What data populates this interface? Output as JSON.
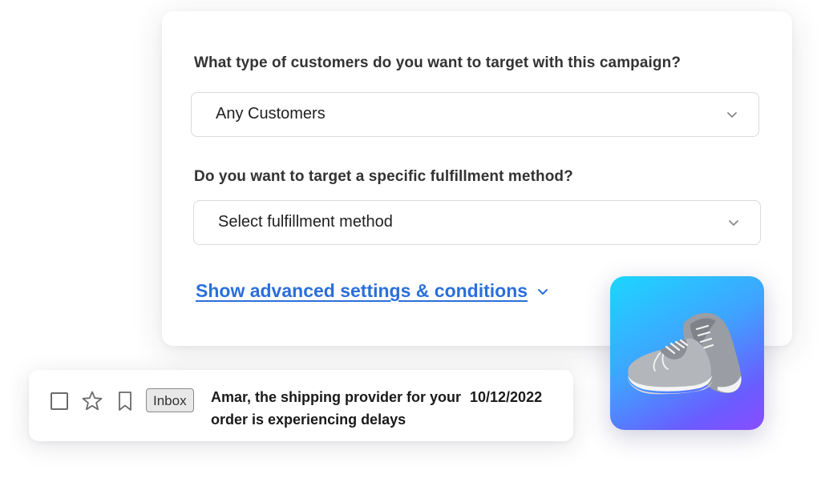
{
  "form": {
    "question_customers": "What type of customers do you want to target with this campaign?",
    "customers_select": {
      "value": "Any Customers"
    },
    "question_fulfillment": "Do you want to target a specific fulfillment method?",
    "fulfillment_select": {
      "value": "Select fulfillment method"
    },
    "advanced_link": "Show advanced settings & conditions"
  },
  "email": {
    "badge": "Inbox",
    "subject": "Amar, the shipping provider for your order is experiencing delays",
    "date": "10/12/2022"
  },
  "icons": {
    "select_chevron": "chevron-down-icon",
    "advanced_chevron": "chevron-down-icon",
    "checkbox": "checkbox-icon",
    "star": "star-icon",
    "bookmark": "bookmark-icon",
    "product": "sneakers-image"
  },
  "colors": {
    "link": "#2a6fdb",
    "question_text": "#333333",
    "select_border": "#d9d9df",
    "product_gradient_start": "#1cd6ff",
    "product_gradient_end": "#8a4dff"
  }
}
